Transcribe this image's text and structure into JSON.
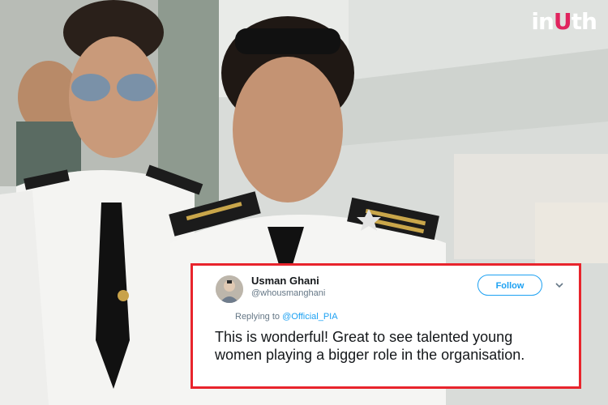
{
  "brand": {
    "logo_main": "in",
    "logo_accent": "U",
    "logo_tail": "th"
  },
  "tweet": {
    "display_name": "Usman Ghani",
    "handle": "@whousmanghani",
    "follow_label": "Follow",
    "replying_prefix": "Replying to",
    "replying_mention": "@Official_PIA",
    "text": "This is wonderful! Great to see talented young women playing a bigger role in the organisation."
  },
  "colors": {
    "border": "#e8242c",
    "link": "#1da1f2",
    "logo_accent": "#e0245e"
  },
  "icons": {
    "avatar": "user-avatar",
    "more": "chevron-down-icon"
  }
}
